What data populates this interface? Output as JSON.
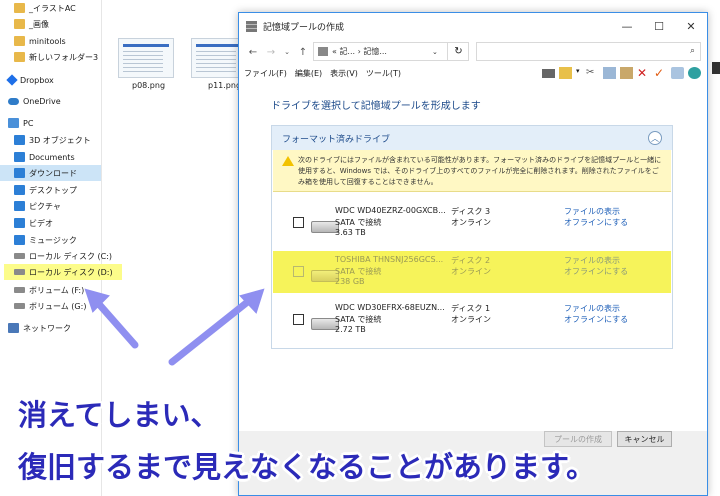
{
  "explorer": {
    "nav_items": [
      {
        "label": "_イラストAC",
        "icon": "folder-icon"
      },
      {
        "label": "_画像",
        "icon": "folder-icon"
      },
      {
        "label": "minitools",
        "icon": "folder-icon"
      },
      {
        "label": "新しいフォルダー3",
        "icon": "folder-icon"
      },
      {
        "label": "Dropbox",
        "icon": "dropbox-icon"
      },
      {
        "label": "OneDrive",
        "icon": "cloud-icon"
      },
      {
        "label": "PC",
        "icon": "pc-icon"
      },
      {
        "label": "3D オブジェクト",
        "icon": "3d-objects-icon"
      },
      {
        "label": "Documents",
        "icon": "documents-icon"
      },
      {
        "label": "ダウンロード",
        "icon": "download-icon"
      },
      {
        "label": "デスクトップ",
        "icon": "desktop-icon"
      },
      {
        "label": "ピクチャ",
        "icon": "pictures-icon"
      },
      {
        "label": "ビデオ",
        "icon": "video-icon"
      },
      {
        "label": "ミュージック",
        "icon": "music-icon"
      },
      {
        "label": "ローカル ディスク (C:)",
        "icon": "drive-icon"
      },
      {
        "label": "ローカル ディスク (D:)",
        "icon": "drive-icon"
      },
      {
        "label": "ボリューム (F:)",
        "icon": "drive-icon"
      },
      {
        "label": "ボリューム (G:)",
        "icon": "drive-icon"
      },
      {
        "label": "ネットワーク",
        "icon": "network-icon"
      }
    ],
    "files": [
      {
        "name": "p08.png"
      },
      {
        "name": "p11.png"
      }
    ]
  },
  "dialog": {
    "title": "記憶域プールの作成",
    "address": "« 記... › 記憶...",
    "menu": [
      "ファイル(F)",
      "編集(E)",
      "表示(V)",
      "ツール(T)"
    ],
    "heading": "ドライブを選択して記憶域プールを形成します",
    "panel_title": "フォーマット済みドライブ",
    "warning": "次のドライブにはファイルが含まれている可能性があります。フォーマット済みのドライブを記憶域プールと一緒に使用すると、Windows では、そのドライブ上のすべてのファイルが完全に削除されます。削除されたファイルをごみ箱を使用して回復することはできません。",
    "drives": [
      {
        "name": "WDC WD40EZRZ-00GXCB...",
        "connection": "SATA で接続",
        "size": "3.63 TB",
        "disk": "ディスク 3",
        "status": "オンライン",
        "link_show": "ファイルの表示",
        "link_offline": "オフラインにする",
        "checked": false,
        "highlighted": false
      },
      {
        "name": "TOSHIBA THNSNJ256GCS...",
        "connection": "SATA で接続",
        "size": "238 GB",
        "disk": "ディスク 2",
        "status": "オンライン",
        "link_show": "ファイルの表示",
        "link_offline": "オフラインにする",
        "checked": false,
        "highlighted": true
      },
      {
        "name": "WDC WD30EFRX-68EUZN...",
        "connection": "SATA で接続",
        "size": "2.72 TB",
        "disk": "ディスク 1",
        "status": "オンライン",
        "link_show": "ファイルの表示",
        "link_offline": "オフラインにする",
        "checked": false,
        "highlighted": false
      }
    ],
    "create_button": "プールの作成",
    "cancel_button": "キャンセル"
  },
  "annotation": {
    "line1": "消えてしまい、",
    "line2": "復旧するまで見えなくなることがあります。",
    "color": "#2b2ab8",
    "arrow_color": "#8f8ff0",
    "highlight_color": "#f6f35a"
  }
}
